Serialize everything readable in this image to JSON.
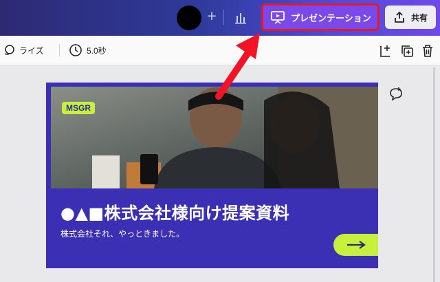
{
  "header": {
    "present_label": "プレゼンテーション",
    "share_label": "共有"
  },
  "toolbar": {
    "animate_label": "ライズ",
    "duration_label": "5.0秒"
  },
  "slide": {
    "badge": "MSGR",
    "title": "●▲■株式会社様向け提案資料",
    "subtitle": "株式会社それ、やっときました。"
  },
  "colors": {
    "slide_bg": "#3b2fb4",
    "accent_lime": "#c7ef3e",
    "present_button": "#7b49e9",
    "highlight_red": "#e21b2c"
  },
  "icons": {
    "present": "presentation-screen-icon",
    "share": "share-upload-icon",
    "animate": "animate-icon",
    "timer": "clock-icon",
    "add_page": "add-page-icon",
    "duplicate": "duplicate-page-icon",
    "delete": "trash-icon",
    "comment": "add-comment-icon",
    "next": "arrow-right-icon"
  }
}
